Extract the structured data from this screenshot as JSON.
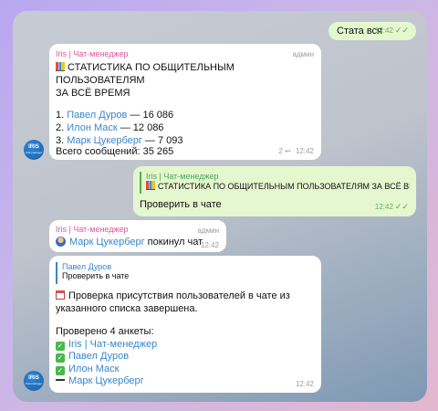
{
  "messages": {
    "m1": {
      "text": "Стата вся",
      "time": "12:42",
      "status": "✓✓"
    },
    "m2": {
      "sender": "Iris | Чат-менеджер",
      "role": "админ",
      "title": "СТАТИСТИКА ПО ОБЩИТЕЛЬНЫМ ПОЛЬЗОВАТЕЛЯМ ЗА ВСЁ ВРЕМЯ",
      "title_line1": "СТАТИСТИКА ПО ОБЩИТЕЛЬНЫМ ПОЛЬЗОВАТЕЛЯМ",
      "title_line2": "ЗА ВСЁ ВРЕМЯ",
      "list": [
        {
          "num": "1.",
          "name": "Павел Дуров",
          "count": " — 16 086"
        },
        {
          "num": "2.",
          "name": "Илон Маск",
          "count": " — 12 086"
        },
        {
          "num": "3.",
          "name": "Марк Цукерберг",
          "count": " — 7 093"
        }
      ],
      "total": "Всего сообщений: 35 265",
      "replies": "2",
      "time": "12:42"
    },
    "m3": {
      "quote_sender": "Iris | Чат-менеджер",
      "quote_text": "СТАТИСТИКА ПО ОБЩИТЕЛЬНЫМ ПОЛЬЗОВАТЕЛЯМ ЗА ВСЁ ВР...",
      "text": "Проверить в чате",
      "time": "12:42",
      "status": "✓✓"
    },
    "m4": {
      "sender": "Iris | Чат-менеджер",
      "role": "админ",
      "name": "Марк Цукерберг",
      "action": " покинул чат",
      "time": "12:42"
    },
    "m5": {
      "quote_sender": "Павел Дуров",
      "quote_text": "Проверить в чате",
      "line1": "Проверка присутствия пользователей в чате из",
      "line2": "указанного списка завершена.",
      "checked": "Проверено 4 анкеты:",
      "results": [
        {
          "name": "Iris | Чат-менеджер",
          "present": true
        },
        {
          "name": "Павел Дуров",
          "present": true
        },
        {
          "name": "Илон Маск",
          "present": true
        },
        {
          "name": "Марк Цукерберг",
          "present": false
        }
      ],
      "time": "12:42"
    }
  },
  "avatar": {
    "label": "IRIS",
    "sub": "chat manager"
  },
  "colors": {
    "sender": "#e2559e",
    "link": "#3a86c8",
    "outgoing": "#e4f7cf"
  }
}
